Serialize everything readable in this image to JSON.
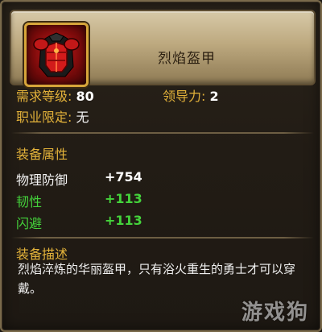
{
  "item": {
    "name": "烈焰盔甲",
    "icon": "red-armor-icon"
  },
  "requirements": {
    "level_label": "需求等级:",
    "level_value": "80",
    "leadership_label": "领导力:",
    "leadership_value": "2",
    "class_label": "职业限定:",
    "class_value": "无"
  },
  "attributes": {
    "heading": "装备属性",
    "rows": [
      {
        "label": "物理防御",
        "value": "+754",
        "color": "#f2f2f2"
      },
      {
        "label": "韧性",
        "value": "+113",
        "color": "#44d33b"
      },
      {
        "label": "闪避",
        "value": "+113",
        "color": "#44d33b"
      }
    ]
  },
  "description": {
    "heading": "装备描述",
    "text": "烈焰淬炼的华丽盔甲，只有浴火重生的勇士才可以穿戴。"
  },
  "watermark": "游戏狗",
  "colors": {
    "label_gold": "#e3b23a",
    "stat_green": "#44d33b",
    "icon_frame": "#d7a53a"
  }
}
